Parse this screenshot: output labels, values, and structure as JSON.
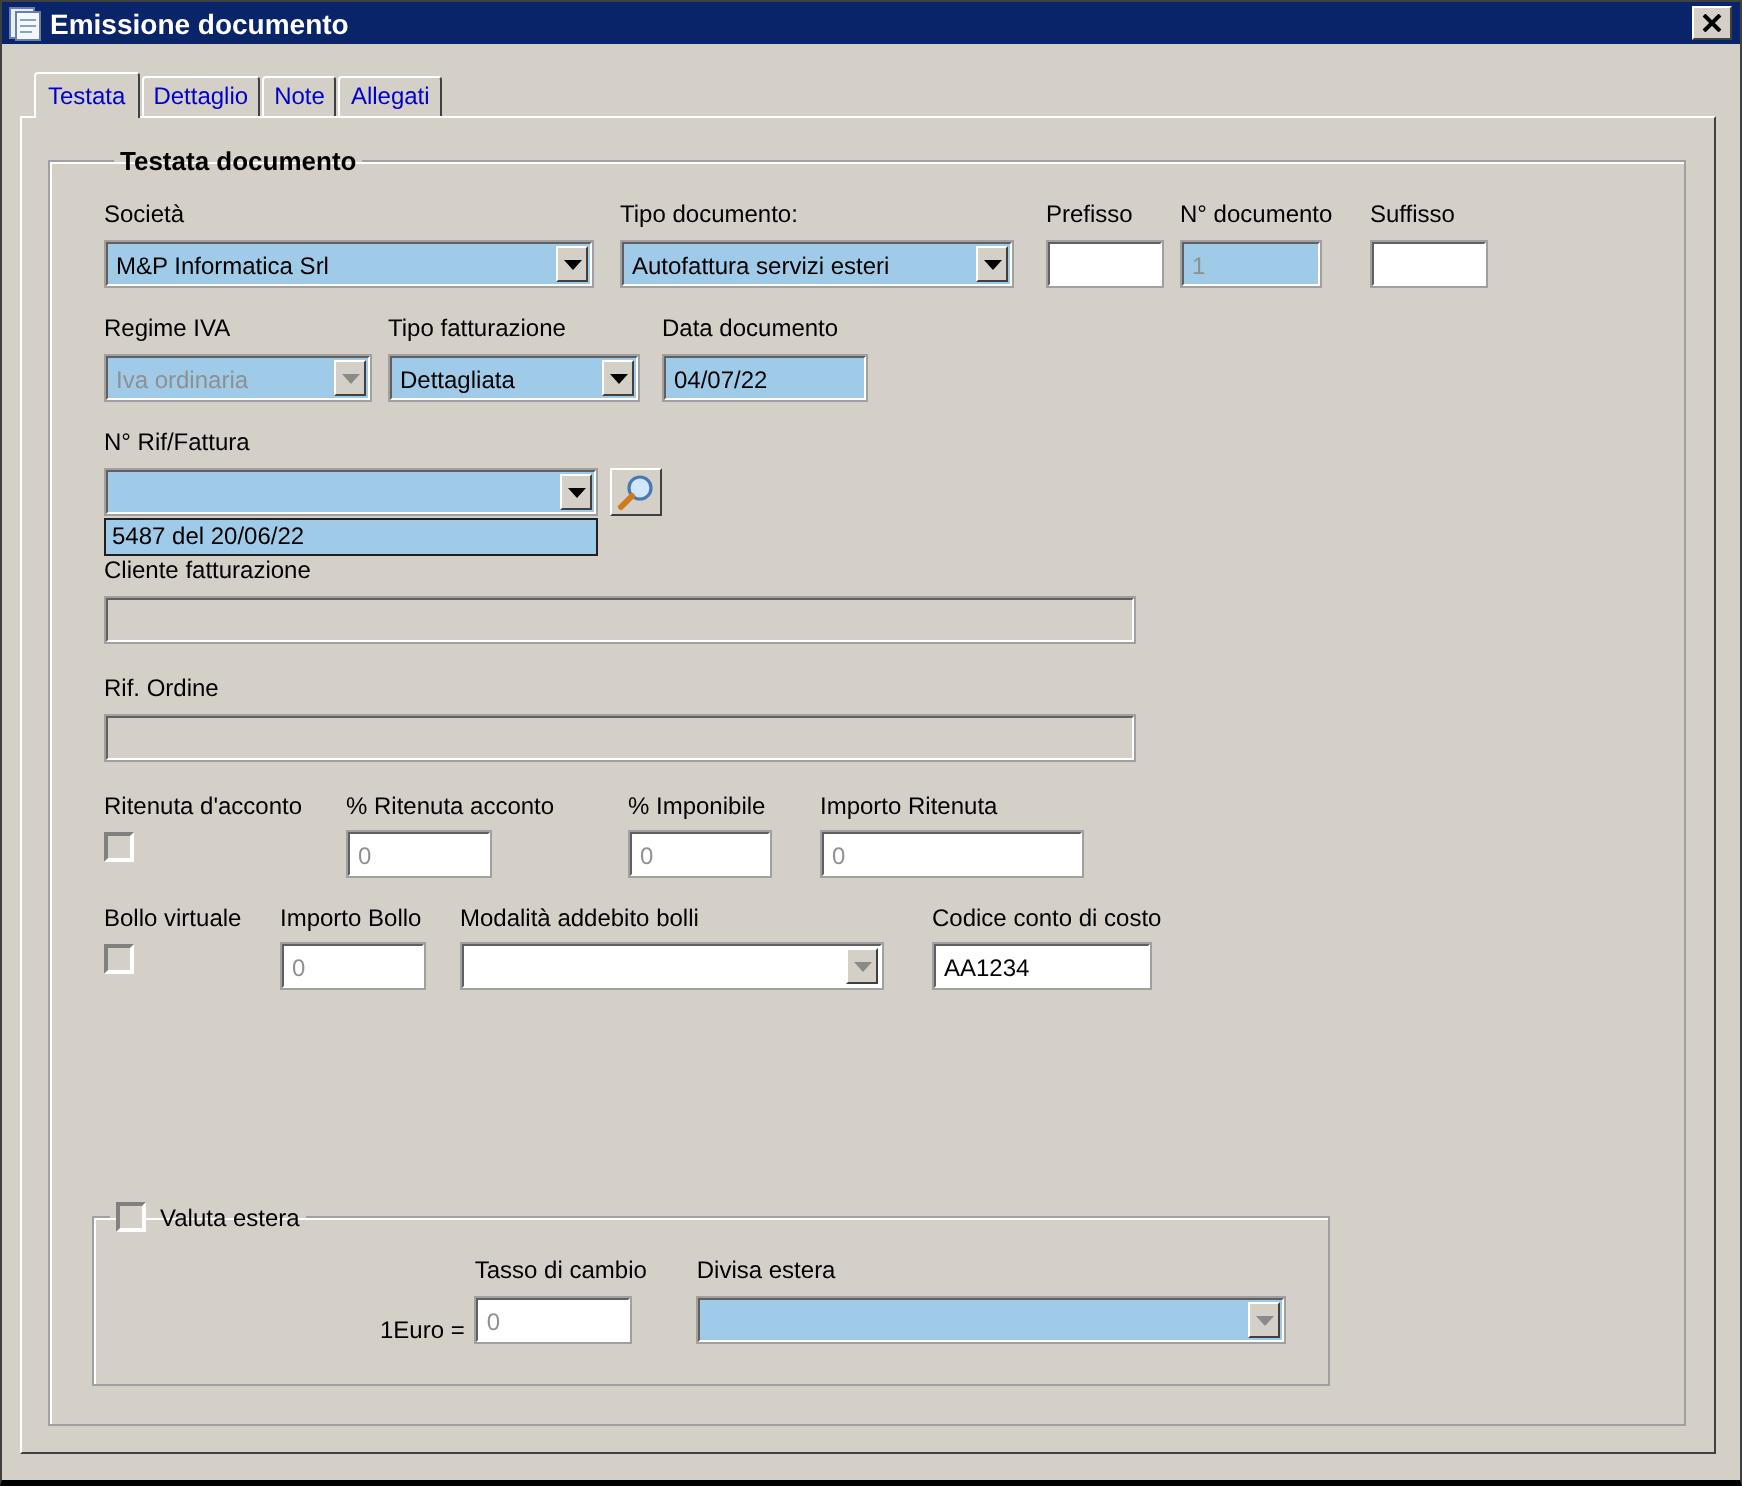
{
  "window": {
    "title": "Emissione documento"
  },
  "tabs": [
    {
      "label": "Testata",
      "selected": true
    },
    {
      "label": "Dettaglio",
      "selected": false
    },
    {
      "label": "Note",
      "selected": false
    },
    {
      "label": "Allegati",
      "selected": false
    }
  ],
  "group": {
    "title": "Testata documento"
  },
  "societa": {
    "label": "Società",
    "value": "M&P Informatica Srl",
    "disabled": false,
    "highlighted": true
  },
  "tipo_documento": {
    "label": "Tipo documento:",
    "value": "Autofattura servizi esteri",
    "disabled": false,
    "highlighted": true
  },
  "prefisso": {
    "label": "Prefisso",
    "highlighted": false,
    "readonly": false
  },
  "numero_documento": {
    "label": "N° documento",
    "value": "1",
    "disabled": true,
    "highlighted": true,
    "readonly": false
  },
  "suffisso": {
    "label": "Suffisso",
    "highlighted": false,
    "readonly": false
  },
  "regime_iva": {
    "label": "Regime IVA",
    "value": "Iva ordinaria",
    "disabled": true,
    "highlighted": true
  },
  "tipo_fatturazione": {
    "label": "Tipo fatturazione",
    "value": "Dettagliata",
    "disabled": false,
    "highlighted": true
  },
  "data_documento": {
    "label": "Data documento",
    "value": "04/07/22",
    "disabled": false,
    "highlighted": true,
    "readonly": false
  },
  "rif_fattura": {
    "label": "N° Rif/Fattura",
    "disabled": false,
    "highlighted": true,
    "dropdown": [
      {
        "label": "5487 del 20/06/22",
        "selected": true
      }
    ]
  },
  "cliente_fatturazione": {
    "label": "Cliente fatturazione",
    "readonly": true
  },
  "rif_ordine": {
    "label": "Rif. Ordine",
    "readonly": true
  },
  "ritenuta": {
    "label": "Ritenuta d'acconto",
    "checked": false
  },
  "perc_ritenuta": {
    "label": "% Ritenuta acconto",
    "value": "0",
    "disabled": true,
    "highlighted": false,
    "readonly": false
  },
  "perc_imponibile": {
    "label": "% Imponibile",
    "value": "0",
    "disabled": true,
    "highlighted": false,
    "readonly": false
  },
  "importo_ritenuta": {
    "label": "Importo Ritenuta",
    "value": "0",
    "disabled": true,
    "highlighted": false,
    "readonly": false
  },
  "bollo": {
    "label": "Bollo virtuale",
    "checked": false
  },
  "importo_bollo": {
    "label": "Importo Bollo",
    "value": "0",
    "disabled": true,
    "highlighted": false,
    "readonly": false
  },
  "modalita_bolli": {
    "label": "Modalità addebito bolli",
    "disabled": true,
    "highlighted": false
  },
  "codice_conto": {
    "label": "Codice conto di costo",
    "value": "AA1234",
    "disabled": false,
    "highlighted": false,
    "readonly": false
  },
  "valuta": {
    "label": "Valuta estera",
    "checked": false,
    "prefix": "1Euro =",
    "tasso": {
      "label": "Tasso di cambio",
      "value": "0",
      "disabled": true,
      "highlighted": false,
      "readonly": false
    },
    "divisa": {
      "label": "Divisa estera",
      "disabled": true,
      "highlighted": true
    }
  }
}
